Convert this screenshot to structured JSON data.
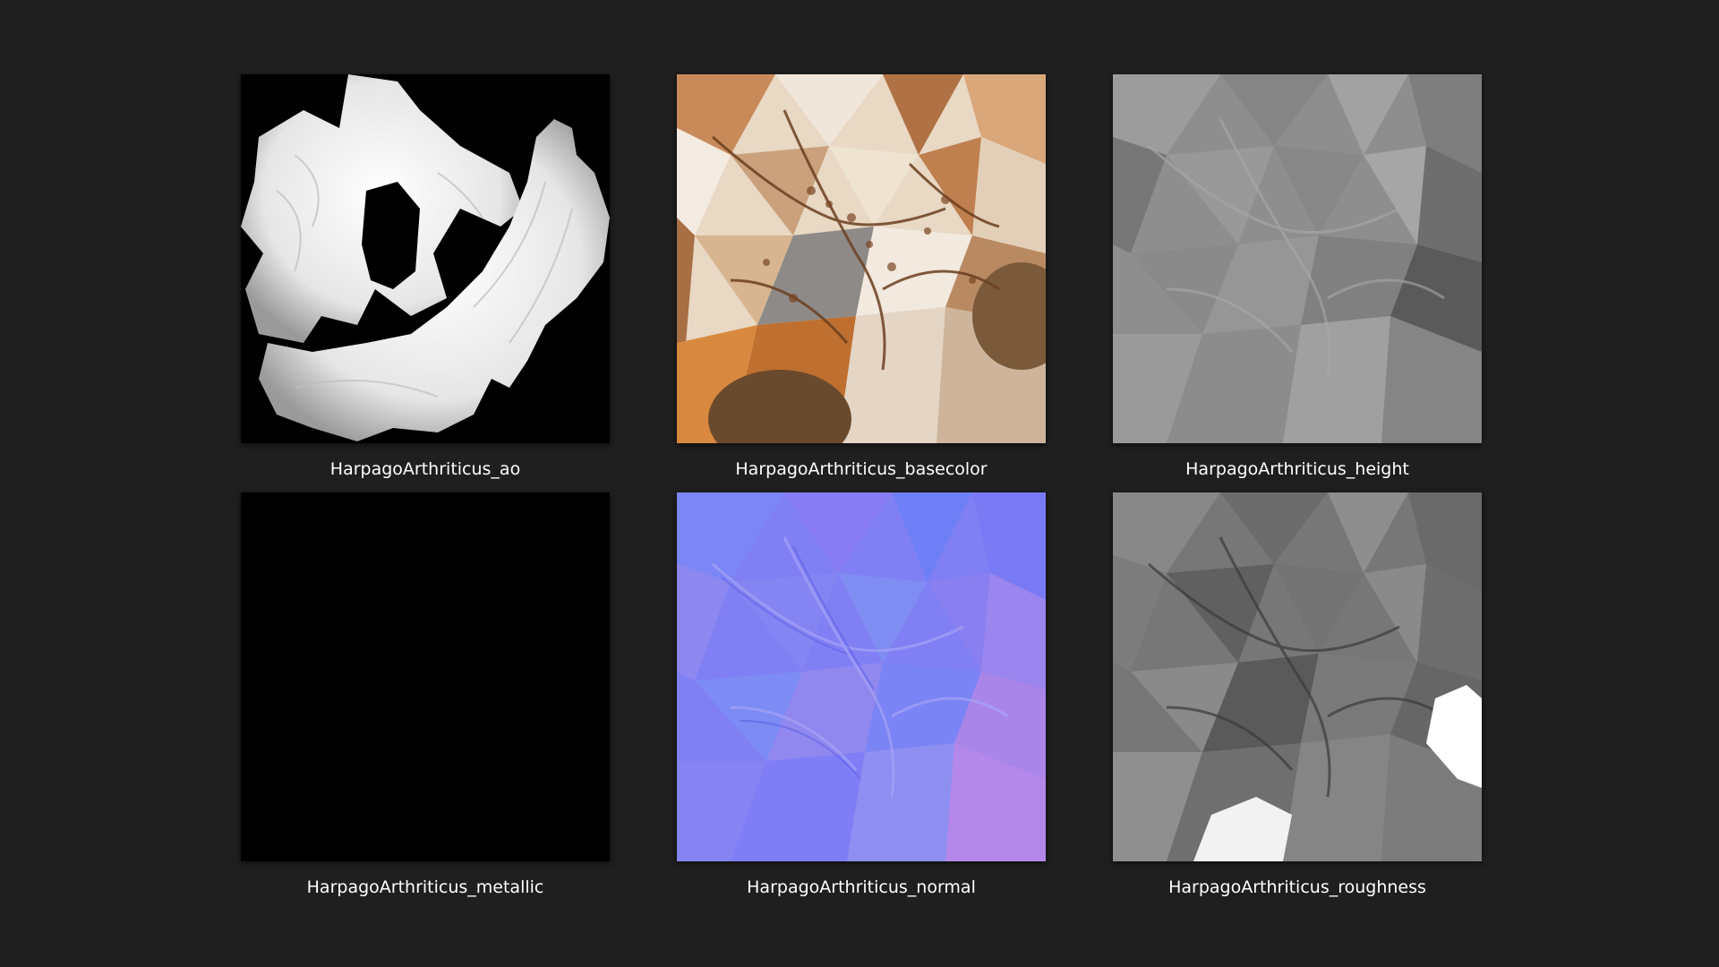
{
  "window": {
    "background_color": "#1f1f1f",
    "text_color": "#ffffff"
  },
  "files": [
    {
      "label": "HarpagoArthriticus_ao",
      "map": "ao"
    },
    {
      "label": "HarpagoArthriticus_basecolor",
      "map": "basecolor"
    },
    {
      "label": "HarpagoArthriticus_height",
      "map": "height"
    },
    {
      "label": "HarpagoArthriticus_metallic",
      "map": "metallic"
    },
    {
      "label": "HarpagoArthriticus_normal",
      "map": "normal"
    },
    {
      "label": "HarpagoArthriticus_roughness",
      "map": "roughness"
    }
  ]
}
